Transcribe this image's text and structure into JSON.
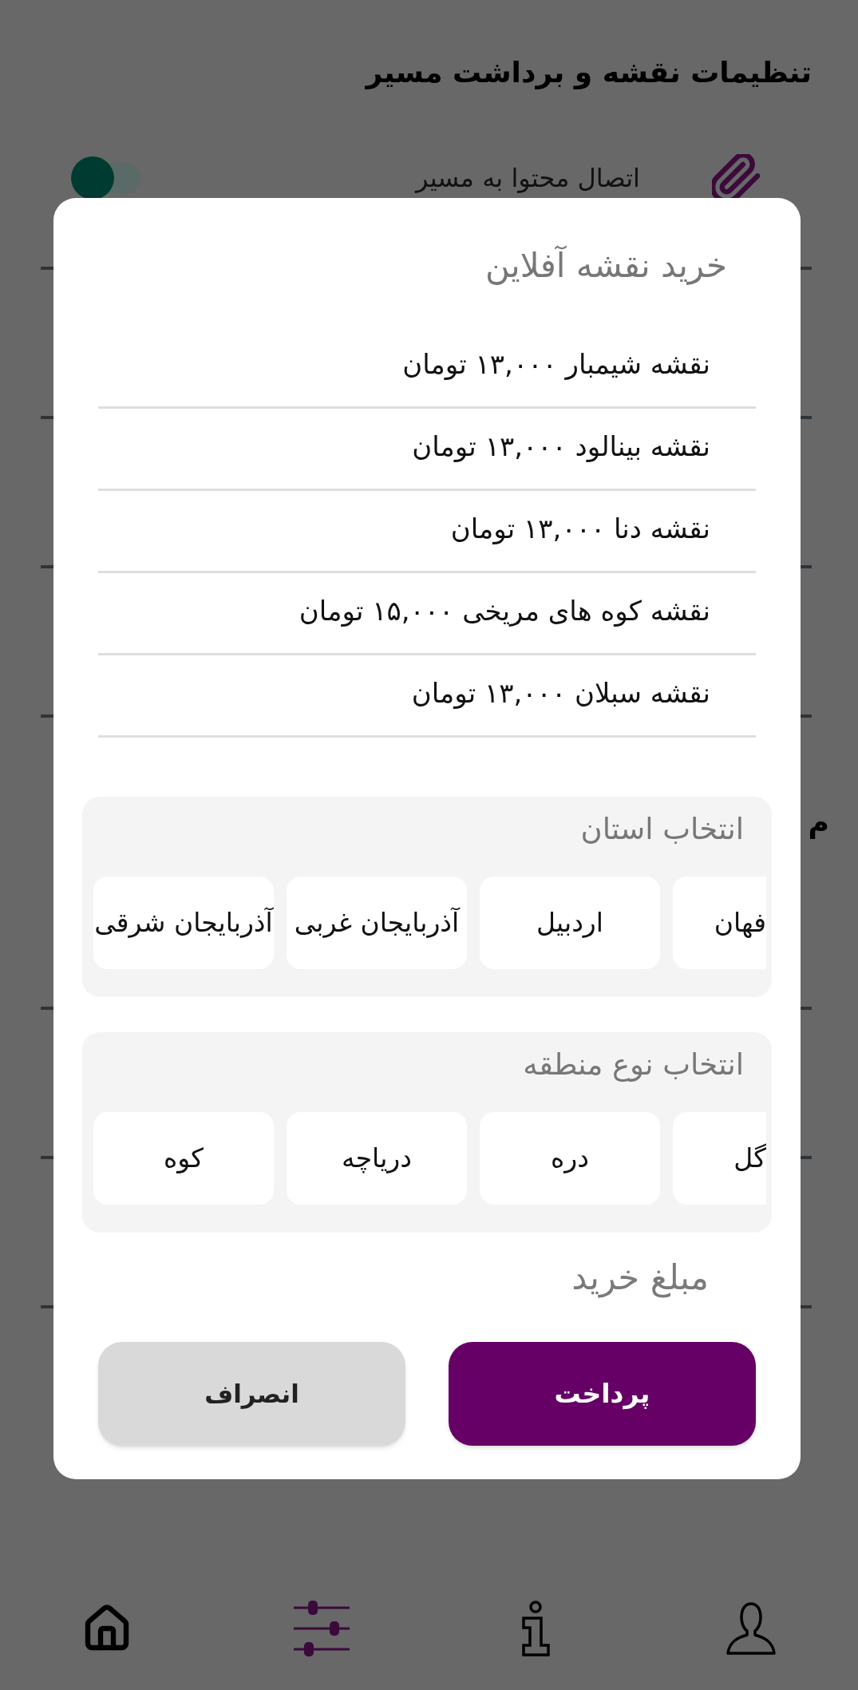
{
  "screen": {
    "title": "تنظیمات نقشه و برداشت مسیر",
    "settings_rows": [
      {
        "label": "اتصال محتوا به مسیر",
        "on": true
      }
    ],
    "section_title": "م"
  },
  "dialog": {
    "title": "خرید نقشه آفلاین",
    "maps": [
      "نقشه شیمبار ۱۳,۰۰۰ تومان",
      "نقشه بینالود ۱۳,۰۰۰ تومان",
      "نقشه دنا ۱۳,۰۰۰ تومان",
      "نقشه کوه های مریخی ۱۵,۰۰۰ تومان",
      "نقشه سبلان ۱۳,۰۰۰ تومان"
    ],
    "province_picker": {
      "title": "انتخاب استان",
      "options": [
        {
          "label": "فهان",
          "selected": false
        },
        {
          "label": "اردبیل",
          "selected": false
        },
        {
          "label": "آذربایجان غربی",
          "selected": false
        },
        {
          "label": "آذربایجان شرقی",
          "selected": false
        }
      ]
    },
    "region_picker": {
      "title": "انتخاب نوع منطقه",
      "options": [
        {
          "label": "گل",
          "selected": false
        },
        {
          "label": "دره",
          "selected": false
        },
        {
          "label": "دریاچه",
          "selected": false
        },
        {
          "label": "کوه",
          "selected": false
        }
      ]
    },
    "price_label": "مبلغ خرید",
    "buttons": [
      {
        "label": "پرداخت",
        "kind": "primary"
      },
      {
        "label": "انصراف",
        "kind": "secondary"
      }
    ]
  },
  "bottom_nav": [
    {
      "kind": "home",
      "selected": false
    },
    {
      "kind": "sliders",
      "selected": true
    },
    {
      "kind": "info",
      "selected": false
    },
    {
      "kind": "person",
      "selected": false
    }
  ]
}
